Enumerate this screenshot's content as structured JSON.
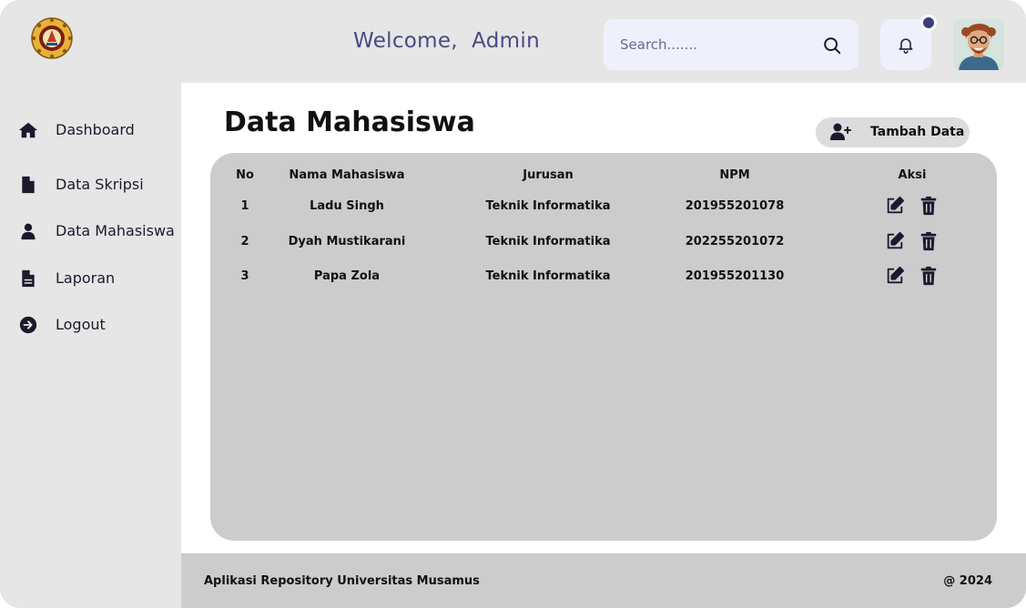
{
  "header": {
    "welcome": "Welcome,  Admin",
    "search_placeholder": "Search.......",
    "search_icon": "search-icon",
    "notification_icon": "bell-icon",
    "avatar": "user-avatar"
  },
  "sidebar": {
    "items": [
      {
        "label": "Dashboard",
        "icon": "home-icon"
      },
      {
        "label": "Data Skripsi",
        "icon": "file-icon"
      },
      {
        "label": "Data Mahasiswa",
        "icon": "user-icon"
      },
      {
        "label": "Laporan",
        "icon": "document-icon"
      },
      {
        "label": "Logout",
        "icon": "logout-icon"
      }
    ]
  },
  "main": {
    "title": "Data Mahasiswa",
    "add_button": "Tambah Data",
    "table": {
      "headers": [
        "No",
        "Nama Mahasiswa",
        "Jurusan",
        "NPM",
        "Aksi"
      ],
      "rows": [
        {
          "no": "1",
          "nama": "Ladu Singh",
          "jurusan": "Teknik Informatika",
          "npm": "201955201078"
        },
        {
          "no": "2",
          "nama": "Dyah Mustikarani",
          "jurusan": "Teknik Informatika",
          "npm": "202255201072"
        },
        {
          "no": "3",
          "nama": "Papa Zola",
          "jurusan": "Teknik Informatika",
          "npm": "201955201130"
        }
      ]
    }
  },
  "footer": {
    "left": "Aplikasi Repository Universitas Musamus",
    "right": "@ 2024"
  },
  "colors": {
    "accent": "#4a4a82",
    "dark": "#1a1a2e",
    "sidebar_bg": "#e6e6e6",
    "table_bg": "#cccccc"
  }
}
